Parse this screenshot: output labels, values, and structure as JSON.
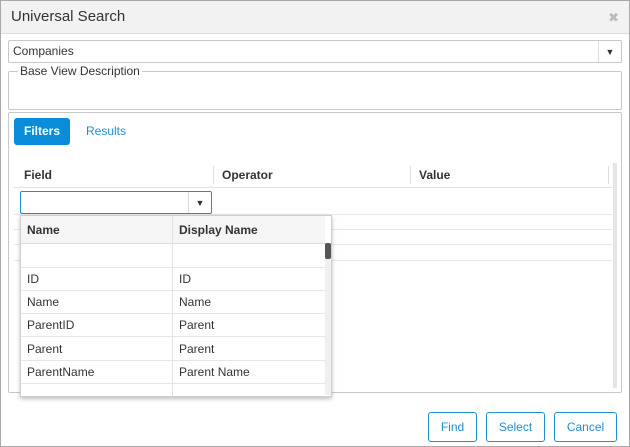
{
  "window": {
    "title": "Universal Search"
  },
  "source_select": {
    "value": "Companies"
  },
  "base_view": {
    "legend": "Base View Description"
  },
  "tabs": [
    {
      "label": "Filters",
      "active": true
    },
    {
      "label": "Results",
      "active": false
    }
  ],
  "filter_grid": {
    "columns": [
      "Field",
      "Operator",
      "Value"
    ]
  },
  "field_dropdown": {
    "columns": [
      "Name",
      "Display Name"
    ],
    "rows": [
      {
        "name": "",
        "display": ""
      },
      {
        "name": "ID",
        "display": "ID"
      },
      {
        "name": "Name",
        "display": "Name"
      },
      {
        "name": "ParentID",
        "display": "Parent"
      },
      {
        "name": "Parent",
        "display": "Parent"
      },
      {
        "name": "ParentName",
        "display": "Parent Name"
      }
    ]
  },
  "buttons": {
    "find": "Find",
    "select": "Select",
    "cancel": "Cancel"
  },
  "colors": {
    "accent": "#0a8dd8",
    "link": "#1e8fd1"
  }
}
